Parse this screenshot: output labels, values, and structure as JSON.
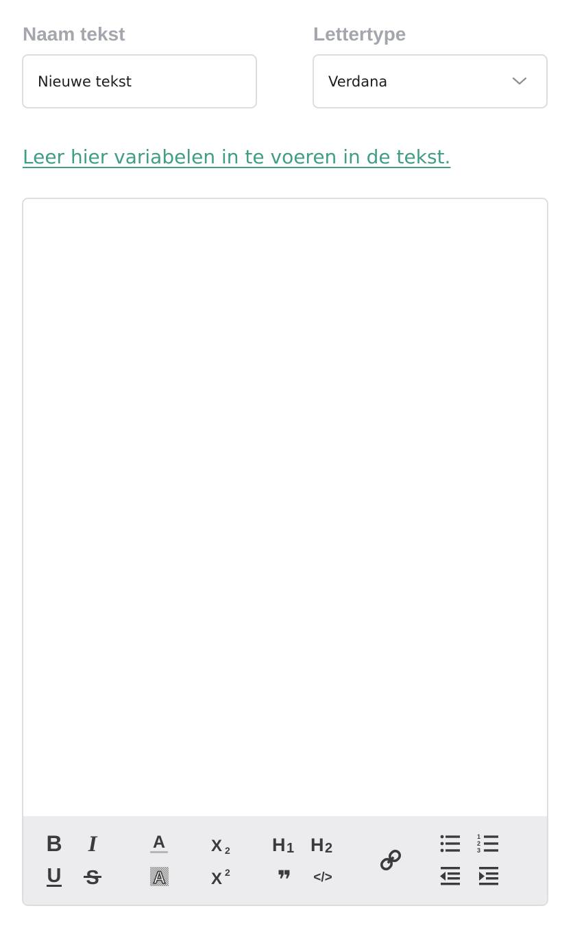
{
  "form": {
    "name_label": "Naam tekst",
    "name_value": "Nieuwe tekst",
    "font_label": "Lettertype",
    "font_value": "Verdana"
  },
  "help_link": "Leer hier variabelen in te voeren in de tekst.",
  "toolbar": {
    "bold": "B",
    "italic": "I",
    "underline": "U",
    "strike": "S",
    "font_color": "A",
    "highlight": "A",
    "subscript_base": "X",
    "subscript_mark": "2",
    "superscript_base": "X",
    "superscript_mark": "2",
    "h1_base": "H",
    "h1_mark": "1",
    "h2_base": "H",
    "h2_mark": "2",
    "quote": "❞",
    "code": "</>"
  },
  "colors": {
    "link": "#3f9d88",
    "label": "#a3a6ad",
    "toolbar_bg": "#ececee",
    "icon": "#3b3b3d"
  }
}
